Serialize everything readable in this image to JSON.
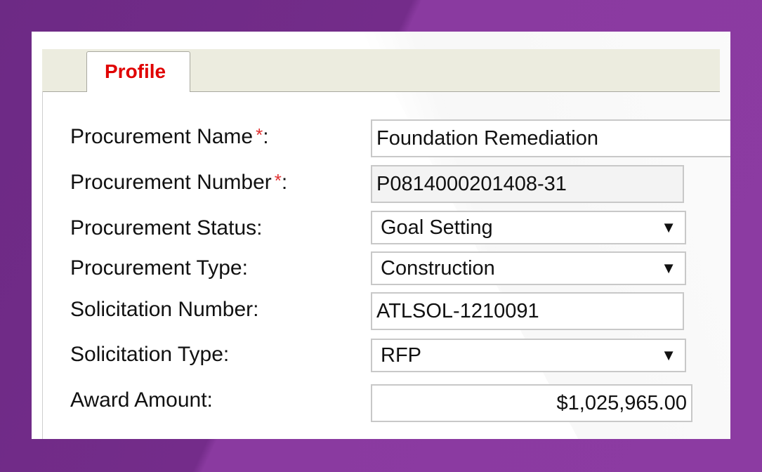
{
  "tabs": [
    {
      "label": "Profile",
      "active": true
    }
  ],
  "form": {
    "procurement_name": {
      "label": "Procurement Name",
      "required_mark": "*",
      "colon": ":",
      "value": "Foundation Remediation"
    },
    "procurement_number": {
      "label": "Procurement Number",
      "required_mark": "*",
      "colon": ":",
      "value": "P0814000201408-31"
    },
    "procurement_status": {
      "label": "Procurement Status:",
      "value": "Goal Setting"
    },
    "procurement_type": {
      "label": "Procurement Type:",
      "value": "Construction"
    },
    "solicitation_number": {
      "label": "Solicitation Number:",
      "value": "ATLSOL-1210091"
    },
    "solicitation_type": {
      "label": "Solicitation Type:",
      "value": "RFP"
    },
    "award_amount": {
      "label": "Award Amount:",
      "value": "$1,025,965.00"
    }
  },
  "icons": {
    "dropdown_arrow": "▼"
  },
  "colors": {
    "background": "#742c8a",
    "tab_label": "#e00000",
    "required": "#e03030"
  }
}
